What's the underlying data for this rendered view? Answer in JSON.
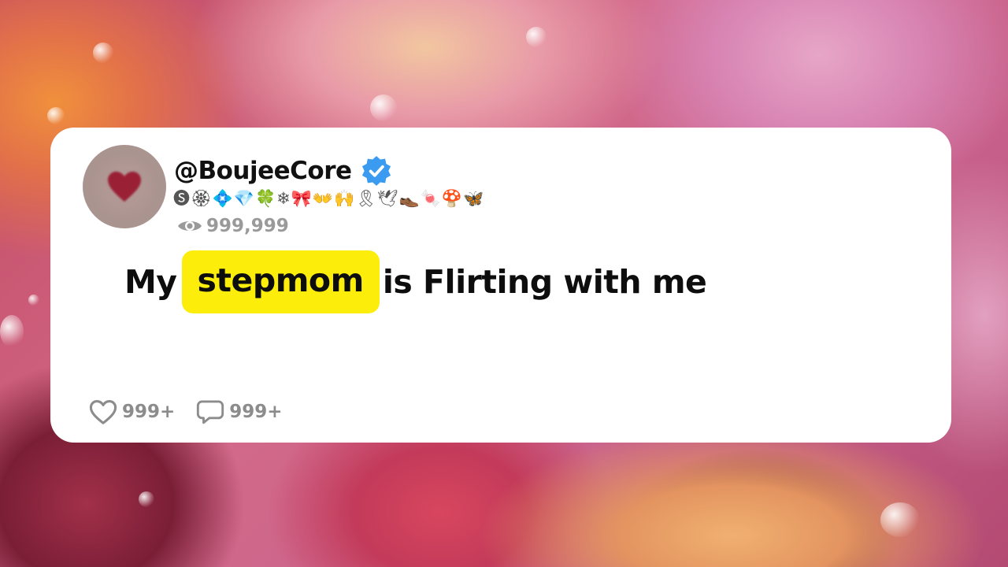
{
  "post": {
    "handle": "@BoujeeCore",
    "verified": true,
    "badges": [
      "🅢",
      "🏵",
      "💠",
      "💎",
      "🍀",
      "❄",
      "🎀",
      "👐",
      "🙌",
      "🎗",
      "🕊",
      "👞",
      "🍬",
      "🍄",
      "🦋"
    ],
    "views": "999,999",
    "message": {
      "before": "My",
      "highlight": "stepmom",
      "after": "is Flirting with me"
    },
    "likes": "999+",
    "comments": "999+"
  },
  "colors": {
    "highlight": "#fcee0a",
    "verified": "#3b9bf0",
    "muted": "#8c8c8c"
  },
  "icons": {
    "verified": "verified-badge-icon",
    "views": "eye-icon",
    "likes": "heart-icon",
    "comments": "comment-icon",
    "avatar": "heart-icon"
  }
}
